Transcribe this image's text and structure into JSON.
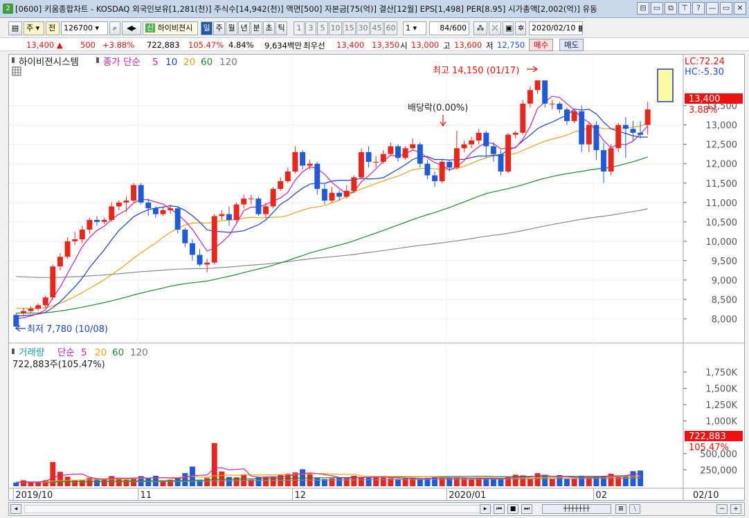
{
  "window": {
    "badge": "2",
    "title": "[0600] 키움종합차트 - KOSDAQ 외국인보유[1,281(천)] 주식수[14,942(천)] 액면[500] 자본금[75(억)] 결산[12월] EPS[1,498] PER[8.95] 시가총액[2,002(억)] 유동",
    "buttons": [
      "⊟",
      "▭",
      "⧉",
      "⊤",
      "?",
      "—",
      "▭",
      "✕"
    ]
  },
  "toolbar": {
    "market": "주",
    "period_sel": "전",
    "code": "126700",
    "new_badge": "신",
    "stock_name": "하이비젼시",
    "periods": [
      "일",
      "주",
      "월",
      "년",
      "분",
      "초",
      "틱"
    ],
    "active_period": "일",
    "intervals": [
      "1",
      "3",
      "5",
      "10",
      "15",
      "30",
      "45",
      "60"
    ],
    "interval_value": "1",
    "count": "84/600",
    "date": "2020/02/10"
  },
  "quote": {
    "price": "13,400 ▲",
    "change": "500",
    "change_pct": "+3.88%",
    "volume": "722,883",
    "vol_ratio": "105.47%",
    "turnover": "4.84%",
    "amount": "9,634백만",
    "best_label": "최우선",
    "ask": "13,400",
    "bid": "13,350",
    "open_label": "시",
    "open": "13,000",
    "high_label": "고",
    "high": "13,600",
    "low_label": "저",
    "low": "12,750",
    "buy": "매수",
    "sell": "매도"
  },
  "price_panel": {
    "name": "하이비젼시스템",
    "ma_legend": {
      "label": "종가 단순",
      "p5": "5",
      "p10": "10",
      "p20": "20",
      "p60": "60",
      "p120": "120"
    },
    "lc": "LC:72.24",
    "hc": "HC:-5.30",
    "last_price": "13,400",
    "last_pct": "3.88%",
    "high_note": "최고 14,150 (01/17)",
    "low_note": "최저 7,780 (10/08)",
    "dividend_note": "배당락(0.00%)"
  },
  "volume_panel": {
    "legend_label": "거래량",
    "legend_sma": "단순",
    "p5": "5",
    "p20": "20",
    "p60": "60",
    "p120": "120",
    "current": "722,883주(105.47%)",
    "last_volume": "722,883",
    "last_pct": "105.47%"
  },
  "x_axis": {
    "labels": [
      "2019/10",
      "11",
      "12",
      "2020/01",
      "02"
    ],
    "right_label": "02/10"
  },
  "chart_data": {
    "type": "candlestick",
    "ylim": [
      7500,
      14600
    ],
    "y_ticks": [
      8000,
      8500,
      9000,
      9500,
      10000,
      10500,
      11000,
      11500,
      12000,
      12500,
      13000,
      13500
    ],
    "y_tick_labels": [
      "8,000",
      "8,500",
      "9,000",
      "9,500",
      "10,000",
      "10,500",
      "11,000",
      "11,500",
      "12,000",
      "12,500",
      "13,000",
      "13,500"
    ],
    "candles": [
      [
        8100,
        7800,
        8150,
        7780
      ],
      [
        8150,
        8200,
        8280,
        8100
      ],
      [
        8200,
        8260,
        8330,
        8150
      ],
      [
        8260,
        8350,
        8400,
        8200
      ],
      [
        8350,
        8550,
        8600,
        8280
      ],
      [
        8550,
        9350,
        9400,
        8500
      ],
      [
        9350,
        9600,
        9700,
        9250
      ],
      [
        9600,
        10000,
        10100,
        9550
      ],
      [
        10000,
        10050,
        10250,
        9900
      ],
      [
        10050,
        10300,
        10400,
        9950
      ],
      [
        10300,
        10550,
        10600,
        10200
      ],
      [
        10550,
        10500,
        10650,
        10400
      ],
      [
        10500,
        10550,
        10600,
        10450
      ],
      [
        10550,
        10900,
        11000,
        10500
      ],
      [
        10900,
        11000,
        11050,
        10800
      ],
      [
        11000,
        11050,
        11150,
        10750
      ],
      [
        11050,
        11450,
        11500,
        11000
      ],
      [
        11450,
        11000,
        11500,
        10950
      ],
      [
        11000,
        10850,
        11100,
        10650
      ],
      [
        10850,
        10700,
        10900,
        10600
      ],
      [
        10700,
        10800,
        10900,
        10650
      ],
      [
        10800,
        10850,
        10950,
        10700
      ],
      [
        10850,
        10300,
        10900,
        10200
      ],
      [
        10300,
        9950,
        10350,
        9850
      ],
      [
        9950,
        9650,
        10050,
        9500
      ],
      [
        9650,
        9400,
        9800,
        9350
      ],
      [
        9400,
        9450,
        9550,
        9200
      ],
      [
        9450,
        10650,
        10700,
        9400
      ],
      [
        10650,
        10700,
        10800,
        10550
      ],
      [
        10700,
        10550,
        10900,
        10400
      ],
      [
        10550,
        10950,
        11000,
        10500
      ],
      [
        10950,
        11100,
        11200,
        10850
      ],
      [
        11100,
        11100,
        11200,
        10950
      ],
      [
        11100,
        10700,
        11150,
        10650
      ],
      [
        10700,
        10900,
        11000,
        10600
      ],
      [
        10900,
        11350,
        11400,
        10850
      ],
      [
        11350,
        11550,
        11650,
        11300
      ],
      [
        11550,
        11800,
        11900,
        11500
      ],
      [
        11800,
        12300,
        12450,
        11750
      ],
      [
        12300,
        11950,
        12350,
        11850
      ],
      [
        11950,
        12000,
        12100,
        11850
      ],
      [
        12000,
        11350,
        12050,
        11200
      ],
      [
        11350,
        11050,
        11500,
        10950
      ],
      [
        11050,
        11250,
        11400,
        11000
      ],
      [
        11250,
        11150,
        11300,
        11050
      ],
      [
        11150,
        11300,
        11450,
        11100
      ],
      [
        11300,
        11650,
        11700,
        11250
      ],
      [
        11650,
        12300,
        12400,
        11600
      ],
      [
        12300,
        12050,
        12450,
        11900
      ],
      [
        12050,
        12050,
        12200,
        11900
      ],
      [
        12050,
        12250,
        12350,
        12000
      ],
      [
        12250,
        12450,
        12550,
        12200
      ],
      [
        12450,
        12150,
        12500,
        12050
      ],
      [
        12150,
        12400,
        12450,
        12100
      ],
      [
        12400,
        12500,
        12650,
        12350
      ],
      [
        12500,
        12000,
        12550,
        11900
      ],
      [
        12000,
        11700,
        12100,
        11600
      ],
      [
        11700,
        11550,
        11800,
        11400
      ],
      [
        11550,
        12050,
        12100,
        11500
      ],
      [
        12050,
        11900,
        12100,
        11800
      ],
      [
        11900,
        12400,
        12850,
        11850
      ],
      [
        12400,
        12500,
        12600,
        12300
      ],
      [
        12500,
        12600,
        12700,
        12400
      ],
      [
        12600,
        12800,
        12900,
        12500
      ],
      [
        12800,
        12450,
        12850,
        12150
      ],
      [
        12450,
        12250,
        12550,
        12050
      ],
      [
        12250,
        11800,
        12350,
        11700
      ],
      [
        11800,
        12750,
        12800,
        11750
      ],
      [
        12750,
        12800,
        12850,
        12650
      ],
      [
        12800,
        13550,
        13650,
        12750
      ],
      [
        13550,
        13900,
        14000,
        13450
      ],
      [
        13900,
        14150,
        14150,
        13800
      ],
      [
        14150,
        13550,
        14150,
        13450
      ],
      [
        13550,
        13550,
        13650,
        13400
      ],
      [
        13550,
        13400,
        13600,
        13300
      ],
      [
        13400,
        13100,
        13450,
        13000
      ],
      [
        13100,
        13350,
        13400,
        13050
      ],
      [
        13350,
        12500,
        13500,
        12300
      ],
      [
        12500,
        13000,
        13050,
        12300
      ],
      [
        13000,
        12350,
        13100,
        12100
      ],
      [
        12350,
        11800,
        12550,
        11500
      ],
      [
        11800,
        12400,
        12500,
        11700
      ],
      [
        12400,
        13000,
        13050,
        12300
      ],
      [
        13000,
        12900,
        13200,
        12150
      ],
      [
        12900,
        12800,
        13100,
        12600
      ],
      [
        12800,
        12750,
        13100,
        12650
      ],
      [
        13000,
        13400,
        13600,
        12750
      ]
    ],
    "volumes_k": [
      55,
      90,
      60,
      60,
      90,
      370,
      220,
      145,
      95,
      100,
      125,
      110,
      115,
      155,
      120,
      100,
      130,
      155,
      120,
      160,
      90,
      100,
      130,
      200,
      300,
      100,
      125,
      660,
      225,
      140,
      135,
      180,
      100,
      135,
      145,
      150,
      170,
      190,
      210,
      260,
      180,
      130,
      110,
      120,
      130,
      120,
      160,
      140,
      130,
      140,
      130,
      120,
      110,
      120,
      130,
      110,
      125,
      140,
      120,
      130,
      130,
      120,
      110,
      120,
      130,
      120,
      110,
      140,
      175,
      165,
      110,
      200,
      175,
      110,
      170,
      110,
      120,
      160,
      130,
      150,
      150,
      190,
      165,
      160,
      230,
      240
    ]
  }
}
